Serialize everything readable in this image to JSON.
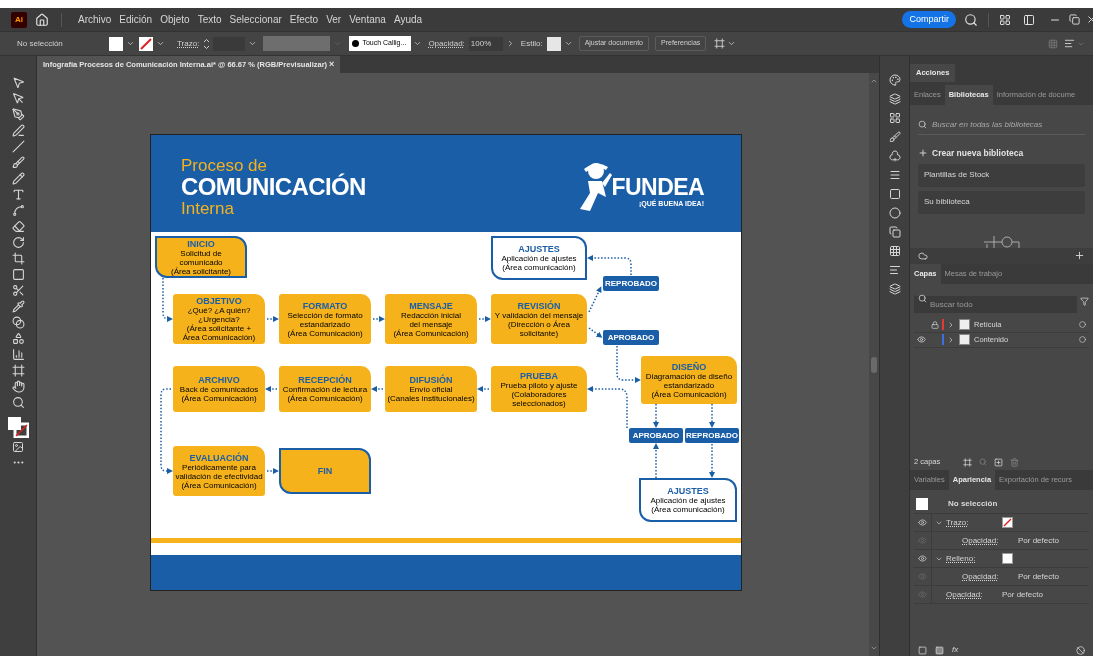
{
  "app": {
    "logo": "Ai",
    "menu": [
      "Archivo",
      "Edición",
      "Objeto",
      "Texto",
      "Seleccionar",
      "Efecto",
      "Ver",
      "Ventana",
      "Ayuda"
    ],
    "share": "Compartir"
  },
  "control_bar": {
    "selection": "No selección",
    "stroke_label": "Trazo:",
    "brush": "Touch Callig...",
    "opacity_label": "Opacidad:",
    "opacity": "100%",
    "style_label": "Estilo:",
    "buttons": [
      "Ajustar documento",
      "Preferencias"
    ]
  },
  "document_tab": {
    "title": "Infografía Procesos de Comunicación Interna.ai* @ 66.67 % (RGB/Previsualizar)",
    "close": "×"
  },
  "artboard": {
    "title_small": "Proceso de",
    "title_big": "COMUNICACIÓN",
    "title_sub": "Interna",
    "brand": "FUNDEA",
    "tagline": "¡QUÉ BUENA IDEA!",
    "nodes": [
      {
        "kind": "terminal",
        "title": "INICIO",
        "text": "Solicitud de comunicado\n(Área solicitante)"
      },
      {
        "kind": "adjust",
        "title": "AJUSTES",
        "text": "Aplicación de ajustes\n(Área comunicación)"
      },
      {
        "kind": "step",
        "title": "OBJETIVO",
        "text": "¿Qué? ¿A quién? ¿Urgencia?\n(Área solicitante +\nÁrea Comunicación)"
      },
      {
        "kind": "step",
        "title": "FORMATO",
        "text": "Selección de formato\nestandarizado\n(Área Comunicación)"
      },
      {
        "kind": "step",
        "title": "MENSAJE",
        "text": "Redacción inicial\ndel mensaje\n(Área Comunicación)"
      },
      {
        "kind": "step",
        "title": "REVISIÓN",
        "text": "Y validación del mensaje\n(Dirección o Área\nsolicitante)"
      },
      {
        "kind": "decision",
        "title": "REPROBADO"
      },
      {
        "kind": "decision",
        "title": "APROBADO"
      },
      {
        "kind": "step",
        "title": "DISEÑO",
        "text": "Diagramación de diseño\nestandarizado\n(Área Comunicación)"
      },
      {
        "kind": "step",
        "title": "ARCHIVO",
        "text": "Back de comunicados\n(Área Comunicación)"
      },
      {
        "kind": "step",
        "title": "RECEPCIÓN",
        "text": "Confirmación de lectura\n(Área Comunicación)"
      },
      {
        "kind": "step",
        "title": "DIFUSIÓN",
        "text": "Envío oficial\n(Canales institucionales)"
      },
      {
        "kind": "step",
        "title": "PRUEBA",
        "text": "Prueba piloto y ajuste\n(Colaboradores\nseleccionados)"
      },
      {
        "kind": "decision",
        "title": "APROBADO"
      },
      {
        "kind": "decision",
        "title": "REPROBADO"
      },
      {
        "kind": "step",
        "title": "EVALUACIÓN",
        "text": "Periódicamente para\nvalidación de efectividad\n(Área Comunicación)"
      },
      {
        "kind": "terminal",
        "title": "FIN"
      },
      {
        "kind": "adjust",
        "title": "AJUSTES",
        "text": "Aplicación de ajustes\n(Área comunicación)"
      }
    ]
  },
  "panels": {
    "top_tab": {
      "label": "Acciones",
      "selected": true
    },
    "library_tabs": [
      {
        "label": "Enlaces",
        "selected": false
      },
      {
        "label": "Bibliotecas",
        "selected": true
      },
      {
        "label": "Información de docume",
        "selected": false
      }
    ],
    "library_search": {
      "placeholder": "Buscar en todas las bibliotecas"
    },
    "create_library": "Crear nueva biblioteca",
    "libraries": [
      "Plantillas de Stock",
      "Su biblioteca"
    ],
    "layer_tabs": [
      {
        "label": "Capas",
        "selected": true
      },
      {
        "label": "Mesas de trabajo",
        "selected": false
      }
    ],
    "layer_search": {
      "placeholder": "Buscar todo"
    },
    "layers": [
      {
        "name": "Retícula",
        "color": "#e5383b",
        "visible": false,
        "locked": true
      },
      {
        "name": "Contenido",
        "color": "#3d6fe0",
        "visible": true,
        "locked": false
      }
    ],
    "layer_count": "2 capas",
    "appearance_tabs": [
      {
        "label": "Variables",
        "selected": false
      },
      {
        "label": "Apariencia",
        "selected": true
      },
      {
        "label": "Exportación de recurs",
        "selected": false
      }
    ],
    "appearance": {
      "title": "No selección",
      "rows": [
        {
          "kind": "stroke",
          "label": "Trazo:",
          "expanded": true,
          "children": [
            {
              "kind": "opacity",
              "label": "Opacidad:",
              "value": "Por defecto"
            }
          ]
        },
        {
          "kind": "fill",
          "label": "Relleno:",
          "expanded": true,
          "children": [
            {
              "kind": "opacity",
              "label": "Opacidad:",
              "value": "Por defecto"
            }
          ]
        },
        {
          "kind": "opacity",
          "label": "Opacidad:",
          "value": "Por defecto"
        }
      ]
    },
    "appearance_fx": "fx"
  }
}
